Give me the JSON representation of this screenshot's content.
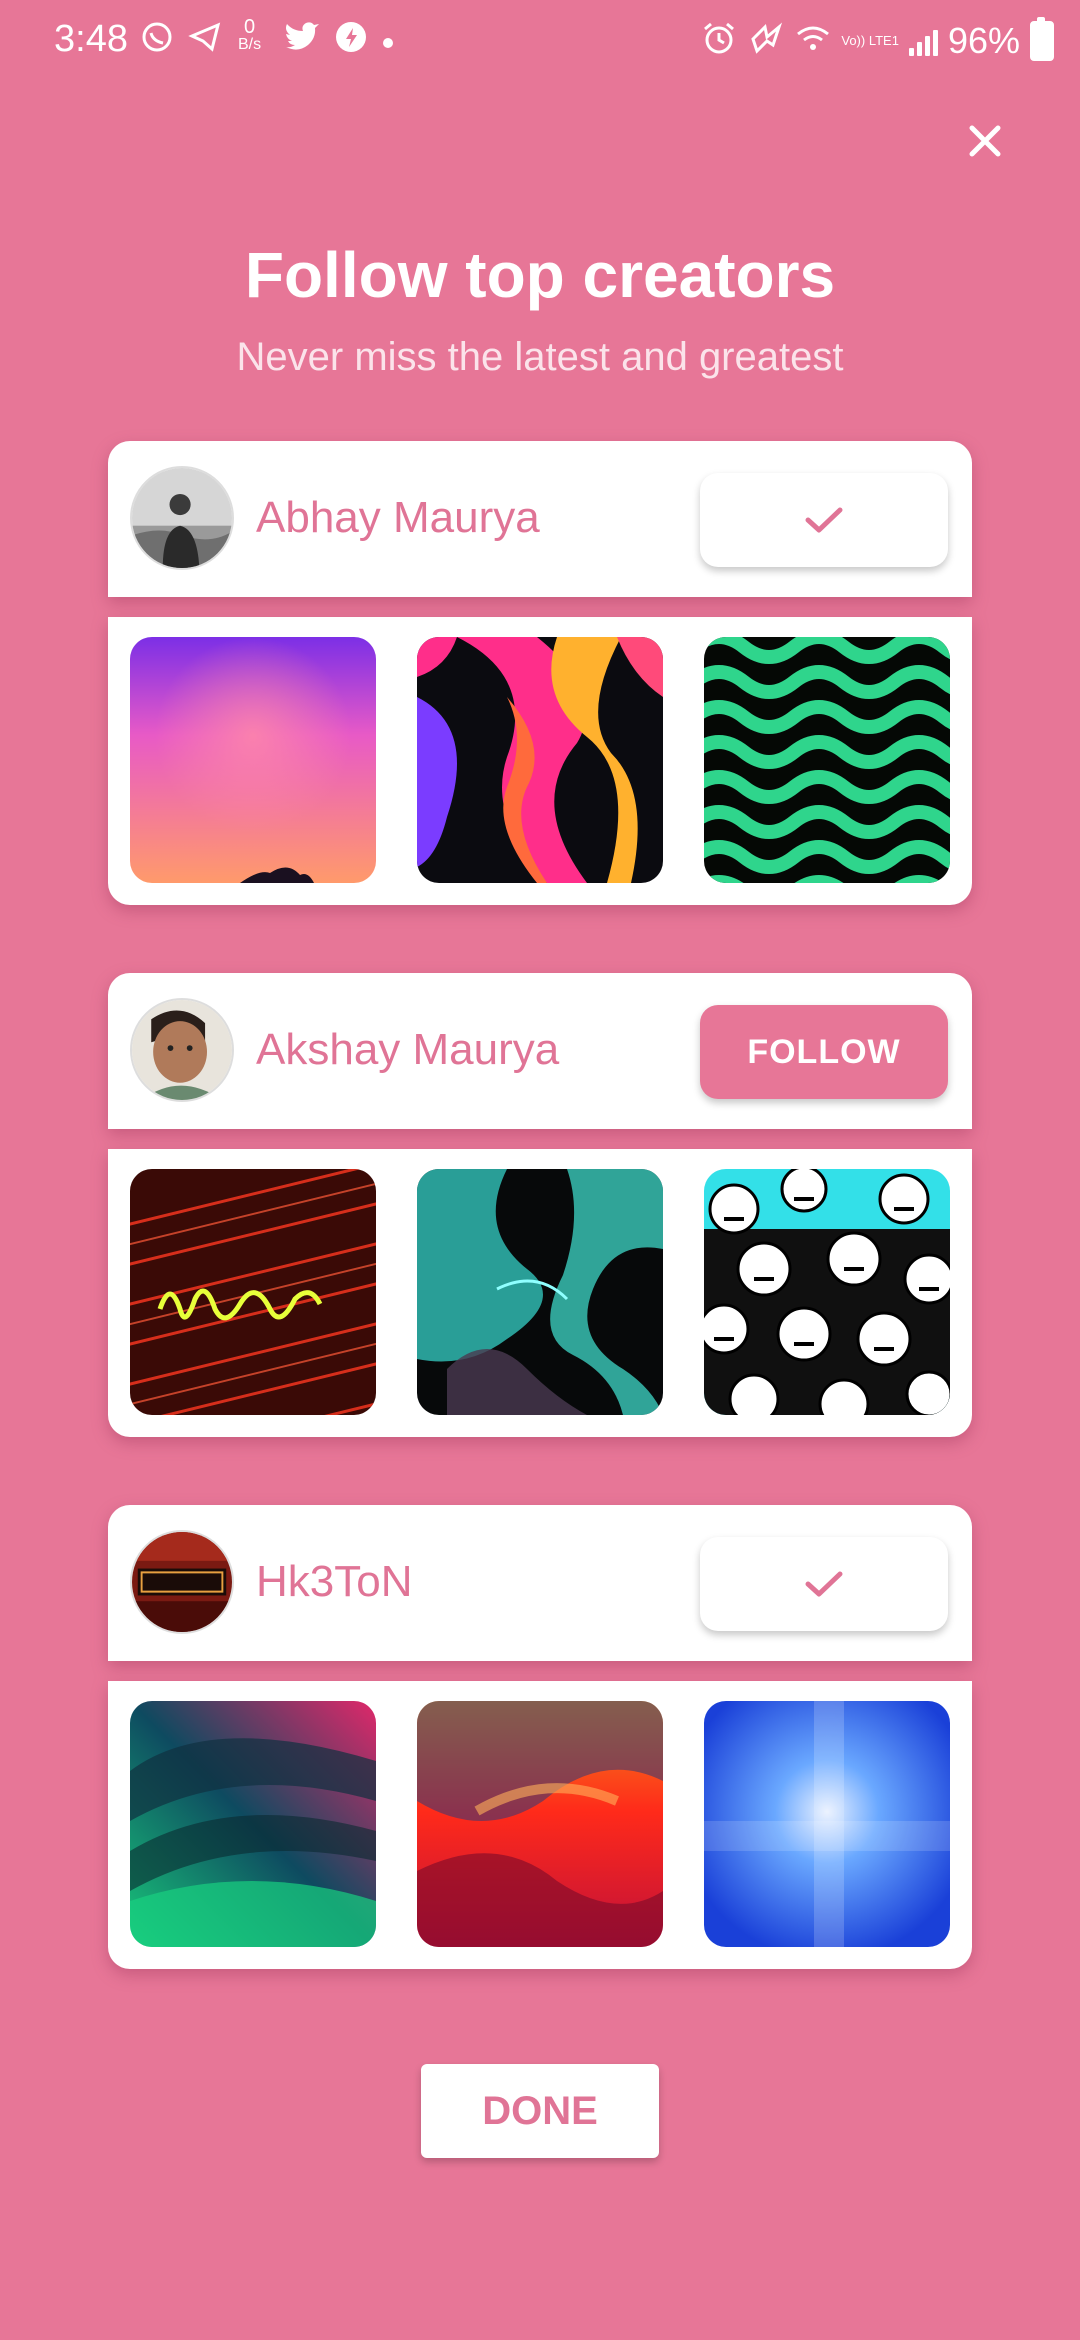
{
  "status_bar": {
    "time": "3:48",
    "speed_value": "0",
    "speed_unit": "B/s",
    "battery": "96%",
    "network": "Vo)) LTE1",
    "left_icons": [
      "whatsapp-icon",
      "telegram-icon",
      "twitter-icon",
      "app-icon",
      "dot-icon"
    ],
    "right_icons": [
      "alarm-icon",
      "nfc-icon",
      "wifi-icon",
      "signal-icon",
      "battery-icon"
    ]
  },
  "header": {
    "title": "Follow top creators",
    "subtitle": "Never miss the latest and greatest"
  },
  "creators": [
    {
      "name": "Abhay Maurya",
      "following": true,
      "button_label": "",
      "wallpapers": [
        "purple-pink-gradient",
        "neon-marble-swirl",
        "green-wave-stripes"
      ]
    },
    {
      "name": "Akshay Maurya",
      "following": false,
      "button_label": "FOLLOW",
      "wallpapers": [
        "fiery-hot-ones-neon",
        "teal-black-marble",
        "cartoon-faces-pattern"
      ]
    },
    {
      "name": "Hk3ToN",
      "following": true,
      "button_label": "",
      "wallpapers": [
        "green-blue-waves",
        "orange-red-gradient",
        "blue-light-blur"
      ]
    }
  ],
  "done_label": "DONE",
  "colors": {
    "background": "#e77697",
    "accent_text": "#e07496",
    "card": "#ffffff"
  }
}
